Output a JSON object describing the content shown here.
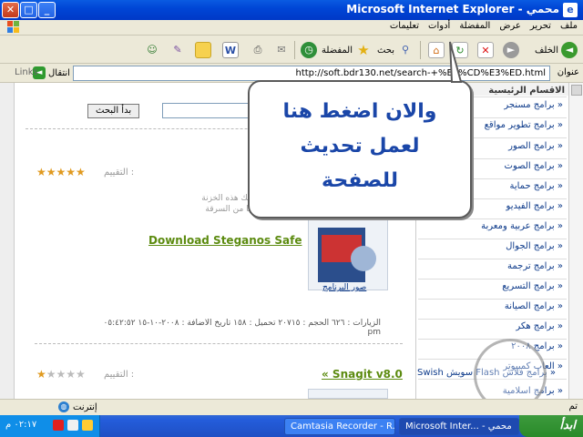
{
  "window": {
    "title": "Microsoft Internet Explorer - محمي",
    "app_icon": "ie-icon",
    "controls": [
      "close",
      "maximize",
      "minimize"
    ]
  },
  "menu": {
    "items": [
      "ملف",
      "تحرير",
      "عرض",
      "المفضلة",
      "أدوات",
      "تعليمات"
    ]
  },
  "toolbar": {
    "back_label": "الخلف",
    "search_label": "بحث",
    "favorites_label": "المفضلة"
  },
  "address": {
    "label": "عنوان",
    "url": "http://soft.bdr130.net/search-+%E3%CD%E3%ED.html",
    "go_label": "انتقال",
    "links_label": "Links"
  },
  "sidebar": {
    "heading": "الاقسام الرئيسية",
    "items": [
      "« برامج مسنجر",
      "« برامج تطوير مواقع",
      "« برامج الصور",
      "« برامج الصوت",
      "« برامج حماية",
      "« برامج الفيديو",
      "« برامج عربية ومعربة",
      "« برامج الجوال",
      "« برامج ترجمة",
      "« برامج التسريع",
      "« برامج الصيانة",
      "« برامج هكر",
      "« برامج ٢٠٠٨",
      "« العاب كمبيوتر",
      "« برامج فلاش Flash سويش Swish",
      "« برامج اسلامية"
    ]
  },
  "main": {
    "search_button": "بدأ البحث",
    "rating_label": "التقييم :",
    "item1": {
      "desc_line1": "أمنية، التي لا غنى لك عنها، حيث تأمن لك هذه الخزنة",
      "desc_line2": "ملة لجميع ملفاتك الخاصة وتحافظ عليها من السرقة",
      "download_link": "Download Steganos Safe",
      "image_caption": "صور البرنامج",
      "meta": "الزيارات : ٦٢٦   الحجم : ٢٠٧١٥   تحميل : ١٥٨   تاريخ الاضافة : ٢٠٠٨-١٠-١٥ ٠٥:٤٢:٥٢ pm",
      "rating": 5
    },
    "item2": {
      "title_link": "« Snagit v8.0",
      "rating": 1
    }
  },
  "callout": {
    "line1": "والان اضغط هنا",
    "line2": "لعمل تحديث",
    "line3": "للصفحة"
  },
  "status": {
    "done": "تم",
    "zone": "إنترنت"
  },
  "taskbar": {
    "start_label": "ابدأ",
    "buttons": [
      "Microsoft Inter... - محمي",
      "Camtasia Recorder - R..."
    ],
    "clock": "٠٢:١٧ م"
  },
  "colors": {
    "titlebar": "#0046d6",
    "taskbar": "#245ddb",
    "start": "#2a8a2a",
    "link_green": "#5c8b10",
    "callout_text": "#1a46a8"
  }
}
